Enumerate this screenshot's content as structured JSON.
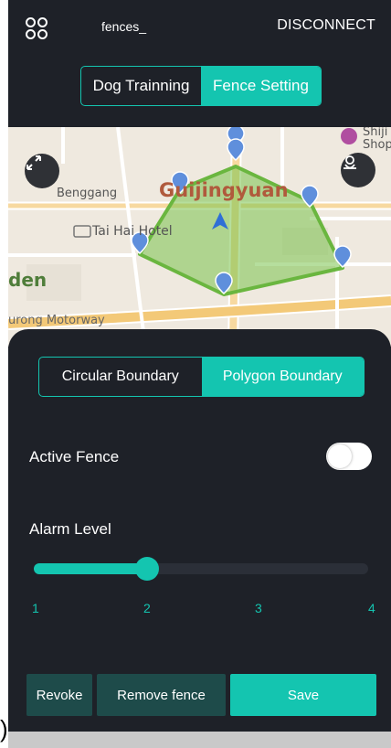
{
  "header": {
    "device_name": "fences_",
    "disconnect_label": "DISCONNECT",
    "menu_icon": "grid-circles-icon"
  },
  "mode_tabs": [
    {
      "label": "Dog Trainning",
      "active": false
    },
    {
      "label": "Fence Setting",
      "active": true
    }
  ],
  "map": {
    "labels": {
      "district": "Guijingyuan",
      "area": "Benggang",
      "hotel": "Tai Hai Hotel",
      "garden_fragment": "den",
      "road": "urong Motorway",
      "shop_line1": "Shiji",
      "shop_line2": "Shop"
    },
    "fence_color": "#6ab63f"
  },
  "boundary_tabs": [
    {
      "label": "Circular Boundary",
      "active": false
    },
    {
      "label": "Polygon Boundary",
      "active": true
    }
  ],
  "active_fence": {
    "label": "Active Fence",
    "enabled": false
  },
  "alarm": {
    "label": "Alarm Level",
    "value": 2,
    "min": 1,
    "max": 4,
    "ticks": [
      "1",
      "2",
      "3",
      "4"
    ]
  },
  "actions": {
    "revoke": "Revoke",
    "remove": "Remove fence",
    "save": "Save"
  },
  "edge_glyph": ")",
  "colors": {
    "accent": "#14c5b0",
    "panel_bg": "#1e2128",
    "secondary_button": "#1e4b4a"
  }
}
